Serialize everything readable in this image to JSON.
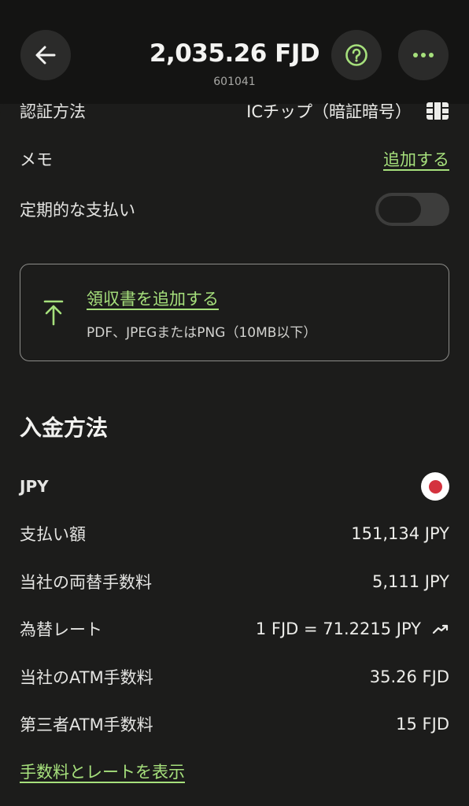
{
  "header": {
    "amount": "2,035.26 FJD",
    "sub_id": "601041"
  },
  "details": {
    "auth_method_label": "認証方法",
    "auth_method_value": "ICチップ（暗証暗号）",
    "memo_label": "メモ",
    "memo_action": "追加する",
    "recurring_label": "定期的な支払い",
    "recurring_enabled": false
  },
  "receipt": {
    "title": "領収書を追加する",
    "subtitle": "PDF、JPEGまたはPNG（10MB以下）"
  },
  "funding": {
    "section_title": "入金方法",
    "currency": "JPY",
    "flag_icon": "japan-flag-icon",
    "rows": [
      {
        "label": "支払い額",
        "value": "151,134 JPY"
      },
      {
        "label": "当社の両替手数料",
        "value": "5,111 JPY"
      },
      {
        "label": "為替レート",
        "value": "1 FJD = 71.2215 JPY"
      },
      {
        "label": "当社のATM手数料",
        "value": "35.26 FJD"
      },
      {
        "label": "第三者ATM手数料",
        "value": "15 FJD"
      }
    ],
    "show_fees_link": "手数料とレートを表示"
  },
  "colors": {
    "accent_green": "#a6e07c",
    "background": "#1c1c1b",
    "header_bg": "#141413"
  }
}
